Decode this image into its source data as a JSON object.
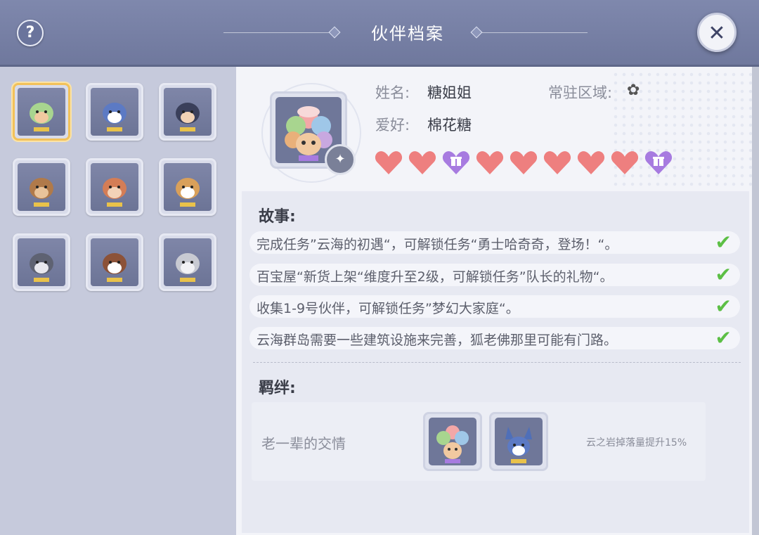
{
  "header": {
    "help_label": "?",
    "title": "伙伴档案",
    "close_label": "✕"
  },
  "companions": [
    {
      "name": "sheep-fluffy-hair",
      "selected": true
    },
    {
      "name": "blue-wolf",
      "selected": false
    },
    {
      "name": "monkey-cap",
      "selected": false
    },
    {
      "name": "deer",
      "selected": false
    },
    {
      "name": "fox-hat",
      "selected": false
    },
    {
      "name": "corgi",
      "selected": false
    },
    {
      "name": "grey-goat",
      "selected": false
    },
    {
      "name": "brown-fox",
      "selected": false
    },
    {
      "name": "grey-cat",
      "selected": false
    }
  ],
  "profile": {
    "name_label": "姓名:",
    "name_value": "糖姐姐",
    "hobby_label": "爱好:",
    "hobby_value": "棉花糖",
    "region_label": "常驻区域:",
    "region_icon": "butterfly-icon",
    "hearts": [
      "heart",
      "heart",
      "gift",
      "heart",
      "heart",
      "heart",
      "heart",
      "heart",
      "gift"
    ]
  },
  "story": {
    "title": "故事:",
    "items": [
      {
        "text": "完成任务”云海的初遇“，可解锁任务“勇士哈奇奇，登场！“。",
        "done": true
      },
      {
        "text": "百宝屋“新货上架“维度升至2级，可解锁任务”队长的礼物“。",
        "done": true
      },
      {
        "text": "收集1-9号伙伴，可解锁任务”梦幻大家庭“。",
        "done": true
      },
      {
        "text": "云海群岛需要一些建筑设施来完善，狐老佛那里可能有门路。",
        "done": true
      }
    ],
    "check_symbol": "✔"
  },
  "bond": {
    "title": "羁绊:",
    "name": "老一辈的交情",
    "effect": "云之岩掉落量提升15%"
  },
  "colors": {
    "heart": "#ee7f7f",
    "gift": "#a77be0",
    "check": "#5cbf45",
    "selected_border": "#f2c15a"
  }
}
